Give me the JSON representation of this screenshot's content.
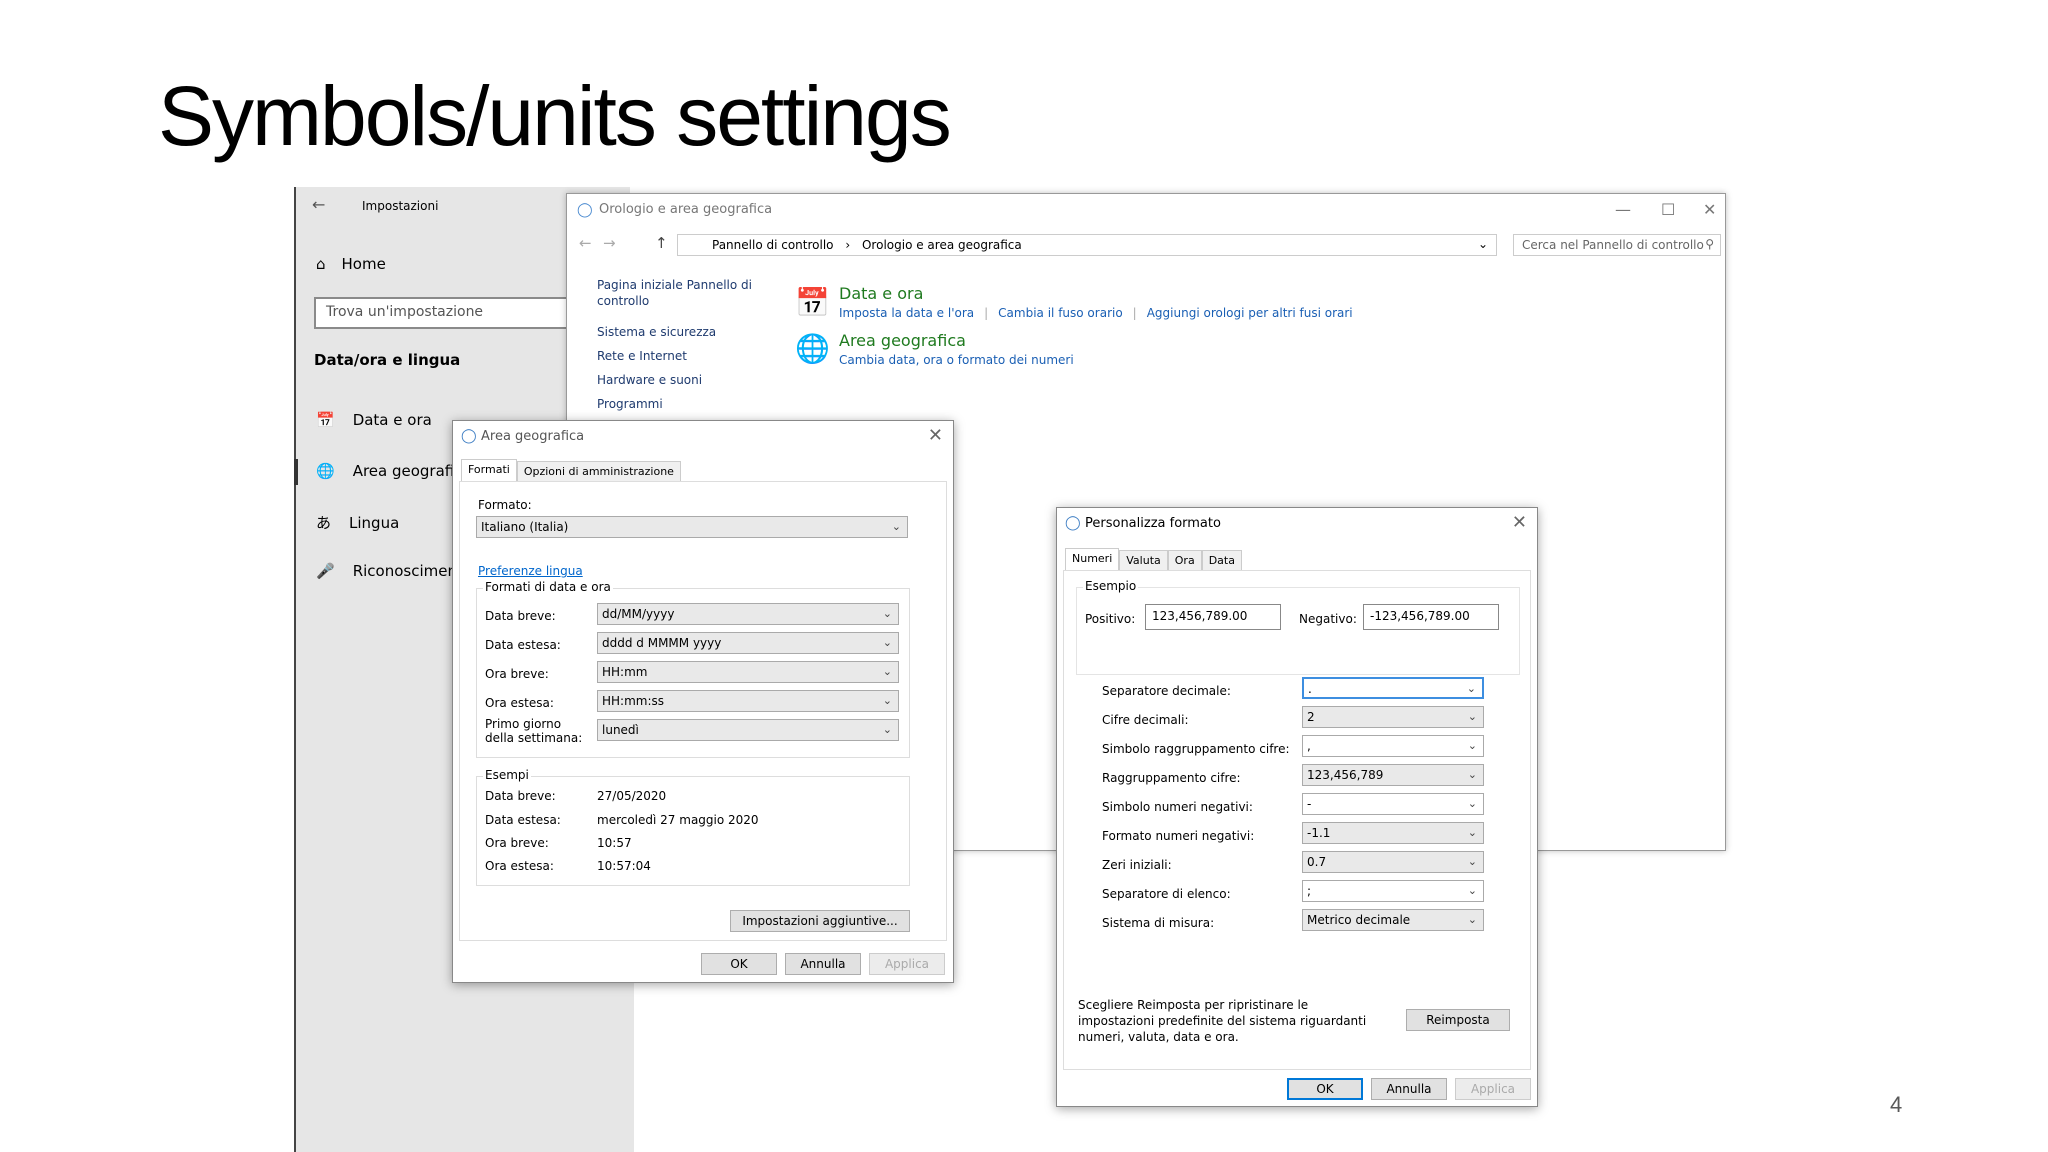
{
  "slide": {
    "title": "Symbols/units settings",
    "page_number": "4"
  },
  "settings": {
    "title": "Impostazioni",
    "home": "Home",
    "search_placeholder": "Trova un'impostazione",
    "section": "Data/ora e lingua",
    "items": [
      {
        "label": "Data e ora",
        "icon": "calendar-clock-icon"
      },
      {
        "label": "Area geografica",
        "icon": "globe-icon"
      },
      {
        "label": "Lingua",
        "icon": "language-icon"
      },
      {
        "label": "Riconoscimento",
        "icon": "microphone-icon"
      }
    ]
  },
  "control_panel": {
    "title": "Orologio e area geografica",
    "breadcrumb": [
      "Pannello di controllo",
      "Orologio e area geografica"
    ],
    "search_placeholder": "Cerca nel Pannello di controllo",
    "left_links": [
      "Pagina iniziale Pannello di controllo",
      "Sistema e sicurezza",
      "Rete e Internet",
      "Hardware e suoni",
      "Programmi"
    ],
    "categories": [
      {
        "title": "Data e ora",
        "links": [
          "Imposta la data e l'ora",
          "Cambia il fuso orario",
          "Aggiungi orologi per altri fusi orari"
        ]
      },
      {
        "title": "Area geografica",
        "links": [
          "Cambia data, ora o formato dei numeri"
        ]
      }
    ]
  },
  "region_dialog": {
    "title": "Area geografica",
    "tabs": [
      "Formati",
      "Opzioni di amministrazione"
    ],
    "format_label": "Formato:",
    "format_value": "Italiano (Italia)",
    "language_link": "Preferenze lingua",
    "date_time_group": "Formati di data e ora",
    "rows": [
      {
        "label": "Data breve:",
        "value": "dd/MM/yyyy"
      },
      {
        "label": "Data estesa:",
        "value": "dddd d MMMM yyyy"
      },
      {
        "label": "Ora breve:",
        "value": "HH:mm"
      },
      {
        "label": "Ora estesa:",
        "value": "HH:mm:ss"
      },
      {
        "label": "Primo giorno della settimana:",
        "value": "lunedì"
      }
    ],
    "examples_group": "Esempi",
    "examples": [
      {
        "label": "Data breve:",
        "value": "27/05/2020"
      },
      {
        "label": "Data estesa:",
        "value": "mercoledì 27 maggio 2020"
      },
      {
        "label": "Ora breve:",
        "value": "10:57"
      },
      {
        "label": "Ora estesa:",
        "value": "10:57:04"
      }
    ],
    "more_button": "Impostazioni aggiuntive...",
    "ok": "OK",
    "cancel": "Annulla",
    "apply": "Applica"
  },
  "custom_dialog": {
    "title": "Personalizza formato",
    "tabs": [
      "Numeri",
      "Valuta",
      "Ora",
      "Data"
    ],
    "example_group": "Esempio",
    "positive_label": "Positivo:",
    "positive_value": "123,456,789.00",
    "negative_label": "Negativo:",
    "negative_value": "-123,456,789.00",
    "rows": [
      {
        "label": "Separatore decimale:",
        "value": "."
      },
      {
        "label": "Cifre decimali:",
        "value": "2"
      },
      {
        "label": "Simbolo raggruppamento cifre:",
        "value": ","
      },
      {
        "label": "Raggruppamento cifre:",
        "value": "123,456,789"
      },
      {
        "label": "Simbolo numeri negativi:",
        "value": "-"
      },
      {
        "label": "Formato numeri negativi:",
        "value": "-1.1"
      },
      {
        "label": "Zeri iniziali:",
        "value": "0.7"
      },
      {
        "label": "Separatore di elenco:",
        "value": ";"
      },
      {
        "label": "Sistema di misura:",
        "value": "Metrico decimale"
      }
    ],
    "reset_note": "Scegliere Reimposta per ripristinare le impostazioni predefinite del sistema riguardanti numeri, valuta, data e ora.",
    "reset_button": "Reimposta",
    "ok": "OK",
    "cancel": "Annulla",
    "apply": "Applica"
  }
}
